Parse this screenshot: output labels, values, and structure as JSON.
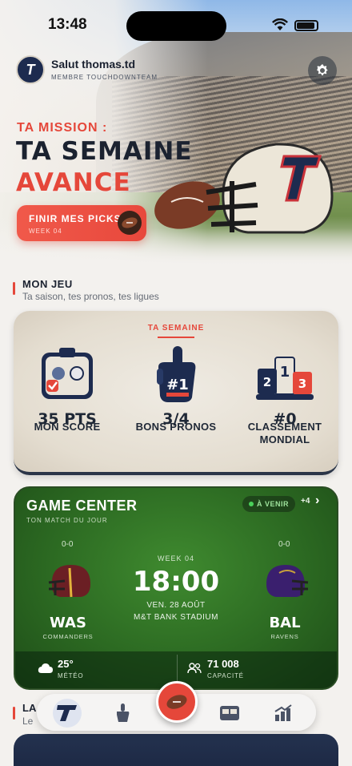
{
  "status_bar": {
    "time": "13:48"
  },
  "header": {
    "greeting": "Salut thomas.td",
    "member": "MEMBRE TOUCHDOWNTEAM",
    "avatar_letter": "T"
  },
  "hero": {
    "mission_label": "TA MISSION :",
    "headline": "TA SEMAINE",
    "headline_accent": "AVANCE",
    "cta_label": "FINIR MES PICKS",
    "cta_sub": "WEEK 04"
  },
  "section_game": {
    "title": "MON JEU",
    "subtitle": "Ta saison, tes pronos, tes ligues"
  },
  "stats_card": {
    "tag": "TA SEMAINE",
    "stats": [
      {
        "label": "MON SCORE",
        "value": "35 PTS",
        "icon": "scoreboard-icon"
      },
      {
        "label": "BONS PRONOS",
        "value": "3/4",
        "icon": "foam-finger-icon"
      },
      {
        "label": "CLASSEMENT MONDIAL",
        "value": "#0",
        "icon": "podium-icon"
      }
    ]
  },
  "game_center": {
    "title": "GAME CENTER",
    "subtitle": "TON MATCH DU JOUR",
    "status": "À VENIR",
    "more": "+4",
    "week": "WEEK 04",
    "kickoff": "18:00",
    "date": "VEN. 28 AOÛT",
    "venue": "M&T BANK STADIUM",
    "home": {
      "abbr": "WAS",
      "name": "COMMANDERS",
      "record": "0-0",
      "color": "#6b1f24"
    },
    "away": {
      "abbr": "BAL",
      "name": "RAVENS",
      "record": "0-0",
      "color": "#3a1f6e"
    },
    "weather_value": "25°",
    "weather_label": "MÉTÉO",
    "capacity_value": "71 008",
    "capacity_label": "CAPACITÉ"
  },
  "section_leagues": {
    "title": "LA",
    "subtitle": "Le"
  },
  "tabbar": {
    "items": [
      "home-logo-icon",
      "foam-finger-icon",
      "football-icon",
      "scoreboard-icon",
      "stats-chart-icon"
    ]
  },
  "colors": {
    "accent": "#e5473a",
    "navy": "#1d2b4f",
    "field": "#2c6a22"
  }
}
